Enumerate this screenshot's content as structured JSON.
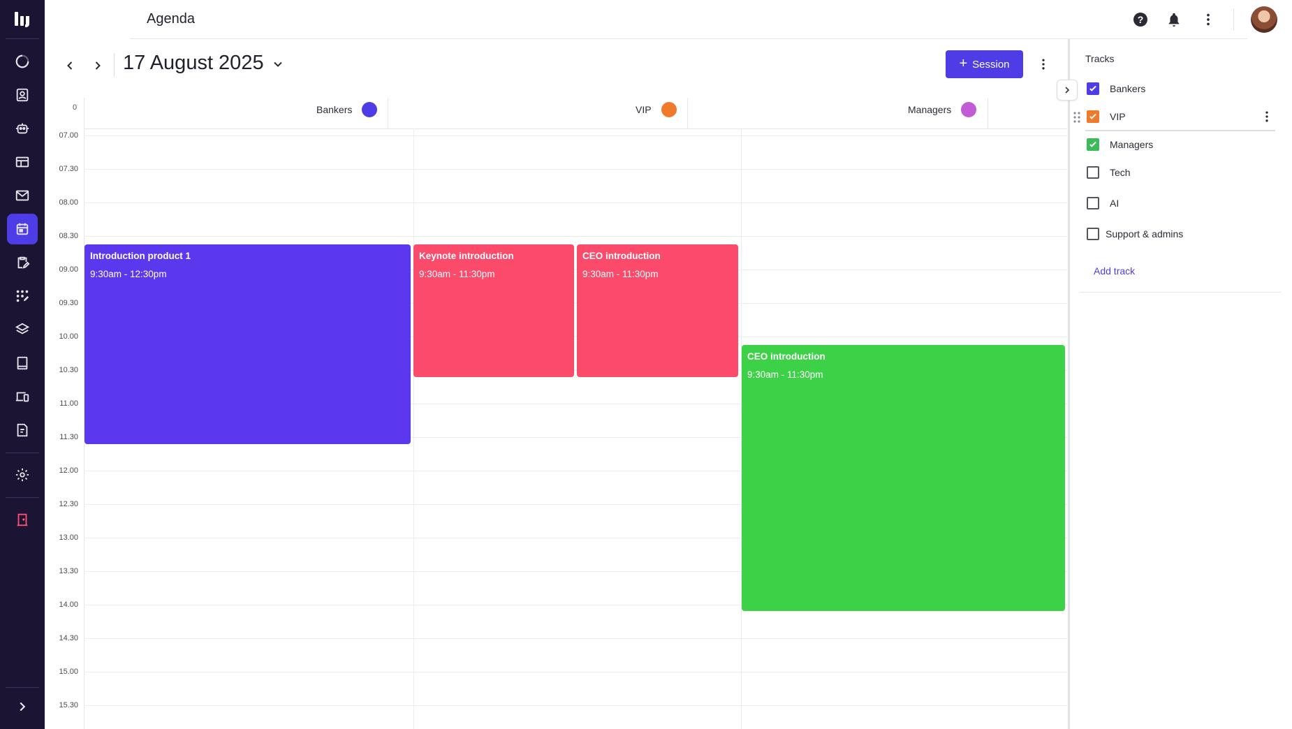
{
  "header": {
    "title": "Agenda",
    "help_icon": "help-circle-icon",
    "notifications_icon": "bell-icon",
    "more_icon": "vertical-dots-icon"
  },
  "sidebar": {
    "items": [
      {
        "icon": "dashboard-icon"
      },
      {
        "icon": "contacts-icon"
      },
      {
        "icon": "bot-icon"
      },
      {
        "icon": "layout-icon"
      },
      {
        "icon": "mail-icon"
      },
      {
        "icon": "calendar-icon",
        "active": true
      },
      {
        "icon": "clipboard-edit-icon"
      },
      {
        "icon": "apps-edit-icon"
      },
      {
        "icon": "layers-icon"
      },
      {
        "icon": "tablet-icon"
      },
      {
        "icon": "devices-icon"
      },
      {
        "icon": "notes-icon"
      },
      {
        "icon": "settings-icon"
      },
      {
        "icon": "exit-icon"
      }
    ],
    "expand_icon": "chevron-right-icon"
  },
  "calendar": {
    "date": "17 August 2025",
    "session_button": "Session",
    "zero_label": "0",
    "tracks": [
      {
        "name": "Bankers",
        "color": "#4e3ce6"
      },
      {
        "name": "VIP",
        "color": "#f07a2c"
      },
      {
        "name": "Managers",
        "color": "#c25bd6"
      }
    ],
    "hours": [
      "07.00",
      "07.30",
      "08.00",
      "08.30",
      "09.00",
      "09.30",
      "10.00",
      "10.30",
      "11.00",
      "11.30",
      "12.00",
      "12.30",
      "13.00",
      "13.30",
      "14.00",
      "14.30",
      "15.00",
      "15.30"
    ],
    "events": [
      {
        "title": "Introduction product 1",
        "time": "9:30am - 12:30pm",
        "color": "#5b38ee"
      },
      {
        "title": "Keynote introduction",
        "time": "9:30am - 11:30pm",
        "color": "#fc4a6b"
      },
      {
        "title": "CEO introduction",
        "time": "9:30am - 11:30pm",
        "color": "#fc4a6b"
      },
      {
        "title": "CEO introduction",
        "time": "9:30am - 11:30pm",
        "color": "#3dd147"
      }
    ]
  },
  "tracks_panel": {
    "title": "Tracks",
    "items": [
      {
        "label": "Bankers",
        "checked": true,
        "color": "#4e3ce6"
      },
      {
        "label": "VIP",
        "checked": true,
        "color": "#f07a2c"
      },
      {
        "label": "Managers",
        "checked": true,
        "color": "#3dbb5a"
      },
      {
        "label": "Tech",
        "checked": false
      },
      {
        "label": "AI",
        "checked": false
      },
      {
        "label": "Support & admins",
        "checked": false
      }
    ],
    "add_track": "Add track"
  }
}
